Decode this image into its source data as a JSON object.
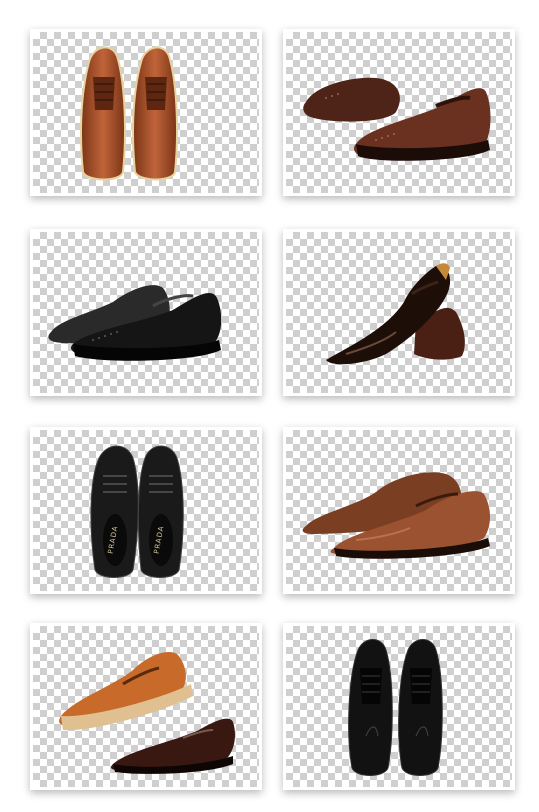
{
  "cards": [
    {
      "name": "brown-oxford-top-view",
      "color": "#a8502a"
    },
    {
      "name": "dark-brown-brogue-pair",
      "color": "#5a2a1c"
    },
    {
      "name": "black-brogue-pair",
      "color": "#1c1c1c"
    },
    {
      "name": "dark-patent-pointed-shoes",
      "color": "#2a1510"
    },
    {
      "name": "black-wingtip-top-view",
      "color": "#1a1a1a",
      "brand": "PRADA"
    },
    {
      "name": "brown-derby-side-view",
      "color": "#8b4a2a"
    },
    {
      "name": "tan-brogue-and-loafer",
      "color": "#c46a2a"
    },
    {
      "name": "black-oxford-top-view",
      "color": "#141414"
    }
  ]
}
